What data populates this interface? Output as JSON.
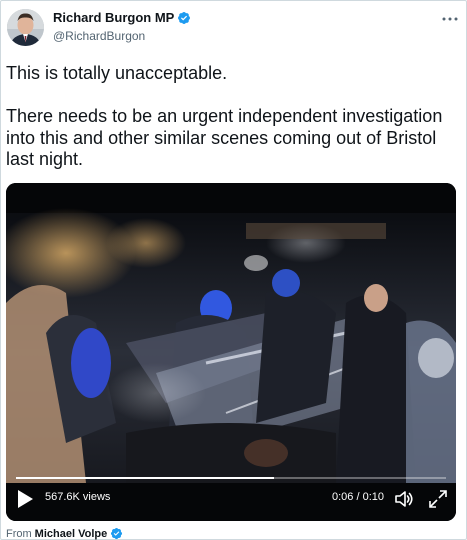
{
  "author": {
    "display_name": "Richard Burgon MP",
    "handle": "@RichardBurgon",
    "verified": true
  },
  "tweet": {
    "paragraph_1": "This is totally unacceptable.",
    "paragraph_2": "There needs to be an urgent independent investigation into this and other similar scenes coming out of Bristol last night."
  },
  "video": {
    "views": "567.6K views",
    "time": "0:06 / 0:10",
    "progress": 0.6
  },
  "attribution": {
    "prefix": "From",
    "source_name": "Michael Volpe",
    "verified": true
  },
  "icons": {
    "more": "more-horizontal-icon",
    "verified": "verified-badge-icon",
    "play": "play-icon",
    "volume": "volume-icon",
    "fullscreen": "fullscreen-icon"
  },
  "colors": {
    "verified_blue": "#1d9bf0",
    "text": "#0f1419",
    "secondary_text": "#536471"
  }
}
